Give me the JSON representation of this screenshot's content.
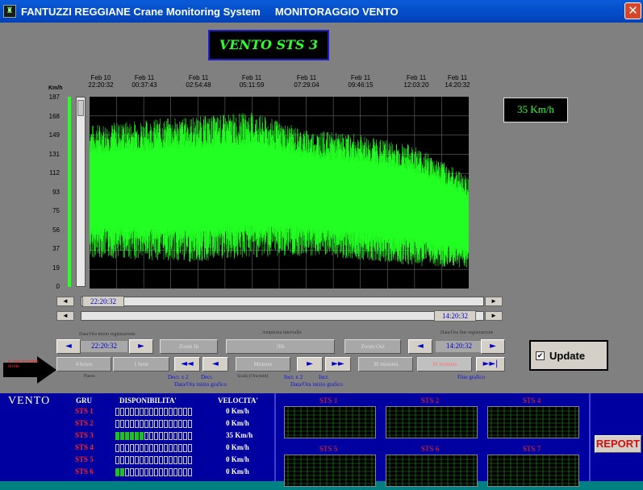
{
  "window": {
    "title": "FANTUZZI REGGIANE Crane Monitoring System     MONITORAGGIO VENTO",
    "close_glyph": "✕",
    "app_icon": "crane-app-icon"
  },
  "workstation": {
    "title": "VENTO STS 3"
  },
  "current_speed": "35 Km/h",
  "chart_data": {
    "type": "line",
    "title": "",
    "ylabel": "Km/h",
    "y_ticks": [
      "187",
      "168",
      "149",
      "131",
      "112",
      "93",
      "75",
      "56",
      "37",
      "19",
      "0"
    ],
    "ylim": [
      0,
      187
    ],
    "x_ticks": [
      {
        "date": "Feb 10",
        "time": "22:20:32"
      },
      {
        "date": "Feb 11",
        "time": "00:37:43"
      },
      {
        "date": "Feb 11",
        "time": "02:54:48"
      },
      {
        "date": "Feb 11",
        "time": "05:11:59"
      },
      {
        "date": "Feb 11",
        "time": "07:29:04"
      },
      {
        "date": "Feb 11",
        "time": "09:46:15"
      },
      {
        "date": "Feb 11",
        "time": "12:03:20"
      },
      {
        "date": "Feb 11",
        "time": "14:20:32"
      }
    ],
    "grid": true,
    "color": "#22ff22",
    "series": [
      {
        "x": [
          "22:20",
          "00:37",
          "02:54",
          "05:11",
          "07:29",
          "09:46",
          "12:03",
          "14:20"
        ],
        "max": [
          160,
          165,
          168,
          172,
          155,
          150,
          140,
          110
        ],
        "min": [
          30,
          28,
          25,
          30,
          32,
          28,
          22,
          20
        ]
      }
    ]
  },
  "scroll": {
    "start_time": "22:20:32",
    "end_time": "14:20:32"
  },
  "controls": {
    "start_caption": "Data/Ora inizio registrazione",
    "interval_caption": "Ampiezza intervallo",
    "end_caption": "Data/Ora fine registrazione",
    "start_value": "22:20:32",
    "zoom_in": "Zoom In",
    "interval_value": "16h",
    "zoom_out": "Zoom Out",
    "end_value": "14:20:32",
    "btn_4hours": "4 hours",
    "btn_1hour": "1 hour",
    "btn_minutes": "Minutes",
    "btn_30min": "30 minutes",
    "btn_10min": "10 minutes",
    "caption_passo": "Passo",
    "caption_decr2": "Decr. x 2",
    "caption_decr": "Decr.",
    "caption_scala": "Scala (Ora:min)",
    "caption_incr2": "Incr. x 2",
    "caption_incr": "Incr.",
    "caption_start_pos": "Data/Ora inizio grafico",
    "caption_end_pos": "Data/Ora inizio grafico",
    "caption_fine": "Fine grafico",
    "warning_text": "In caso le cadute di rete"
  },
  "update": {
    "label": "Update",
    "checked": "✔"
  },
  "summary": {
    "title": "VENTO",
    "headers": {
      "gru": "GRU",
      "disp": "DISPONIBILITA'",
      "vel": "VELOCITA'"
    },
    "rows": [
      {
        "gru": "STS 1",
        "vel": "0 Km/h",
        "on": 0
      },
      {
        "gru": "STS 2",
        "vel": "0 Km/h",
        "on": 0
      },
      {
        "gru": "STS 3",
        "vel": "35 Km/h",
        "on": 6
      },
      {
        "gru": "STS 4",
        "vel": "0 Km/h",
        "on": 0
      },
      {
        "gru": "STS 5",
        "vel": "0 Km/h",
        "on": 0
      },
      {
        "gru": "STS 6",
        "vel": "0 Km/h",
        "on": 2
      }
    ],
    "mini_charts": [
      "STS 1",
      "STS 2",
      "STS 4",
      "STS 5",
      "STS 6",
      "STS 7"
    ],
    "report_label": "REPORT"
  },
  "icons": {
    "left": "◄",
    "right": "►",
    "double_left": "◄◄",
    "double_right": "►►",
    "end": "►►|"
  }
}
